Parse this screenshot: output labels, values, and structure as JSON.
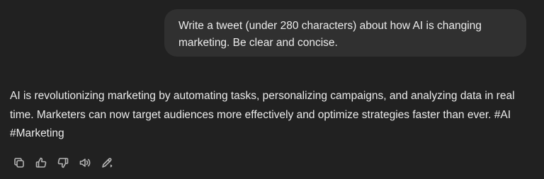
{
  "user_message": {
    "text": "Write a tweet (under 280 characters) about how AI is changing marketing. Be clear and concise."
  },
  "assistant_message": {
    "text": "AI is revolutionizing marketing by automating tasks, personalizing campaigns, and analyzing data in real time. Marketers can now target audiences more effectively and optimize strategies faster than ever. #AI #Marketing"
  },
  "actions": [
    {
      "name": "copy",
      "icon": "copy-icon"
    },
    {
      "name": "good-response",
      "icon": "thumbs-up-icon"
    },
    {
      "name": "bad-response",
      "icon": "thumbs-down-icon"
    },
    {
      "name": "read-aloud",
      "icon": "speaker-icon"
    },
    {
      "name": "edit-in-canvas",
      "icon": "pen-icon"
    }
  ],
  "colors": {
    "background": "#212121",
    "bubble": "#303030",
    "text": "#ececec",
    "icon": "#b4b4b4"
  }
}
